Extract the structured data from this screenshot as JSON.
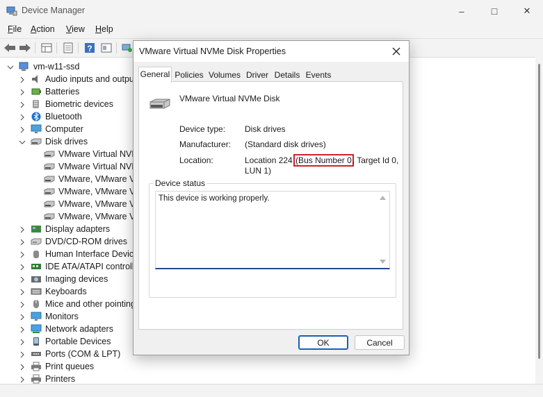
{
  "window": {
    "title": "Device Manager",
    "controls": {
      "minimize": "–",
      "maximize": "□",
      "close": "✕"
    }
  },
  "menu": [
    {
      "key": "F",
      "rest": "ile"
    },
    {
      "key": "A",
      "rest": "ction"
    },
    {
      "key": "V",
      "rest": "iew"
    },
    {
      "key": "H",
      "rest": "elp"
    }
  ],
  "toolbar_icons": [
    "back-icon",
    "forward-icon",
    "properties-grid-icon",
    "doc-icon",
    "help-icon",
    "view-icon",
    "computer-scan-icon"
  ],
  "tree": {
    "root": "vm-w11-ssd",
    "categories_top": [
      {
        "label": "Audio inputs and outputs",
        "icon": "speaker-icon"
      },
      {
        "label": "Batteries",
        "icon": "battery-icon"
      },
      {
        "label": "Biometric devices",
        "icon": "fingerprint-icon"
      },
      {
        "label": "Bluetooth",
        "icon": "bluetooth-icon"
      },
      {
        "label": "Computer",
        "icon": "monitor-icon"
      },
      {
        "label": "Disk drives",
        "icon": "disk-icon"
      }
    ],
    "disk_children": [
      "VMware Virtual NVMe Disk",
      "VMware Virtual NVMe Disk",
      "VMware, VMware Virtual S",
      "VMware, VMware Virtual S",
      "VMware, VMware Virtual S",
      "VMware, VMware Virtual S"
    ],
    "categories_bottom": [
      {
        "label": "Display adapters",
        "icon": "display-icon"
      },
      {
        "label": "DVD/CD-ROM drives",
        "icon": "dvd-icon"
      },
      {
        "label": "Human Interface Devices",
        "icon": "hid-icon"
      },
      {
        "label": "IDE ATA/ATAPI controllers",
        "icon": "ide-icon"
      },
      {
        "label": "Imaging devices",
        "icon": "camera-icon"
      },
      {
        "label": "Keyboards",
        "icon": "keyboard-icon"
      },
      {
        "label": "Mice and other pointing devices",
        "icon": "mouse-icon"
      },
      {
        "label": "Monitors",
        "icon": "monitor-icon"
      },
      {
        "label": "Network adapters",
        "icon": "network-icon"
      },
      {
        "label": "Portable Devices",
        "icon": "portable-icon"
      },
      {
        "label": "Ports (COM & LPT)",
        "icon": "port-icon"
      },
      {
        "label": "Print queues",
        "icon": "printer-icon"
      },
      {
        "label": "Printers",
        "icon": "printer-icon"
      }
    ]
  },
  "dialog": {
    "title": "VMware Virtual NVMe Disk Properties",
    "tabs": [
      "General",
      "Policies",
      "Volumes",
      "Driver",
      "Details",
      "Events"
    ],
    "active_tab": "General",
    "device_name": "VMware Virtual NVMe Disk",
    "device_type_label": "Device type:",
    "device_type_value": "Disk drives",
    "manufacturer_label": "Manufacturer:",
    "manufacturer_value": "(Standard disk drives)",
    "location_label": "Location:",
    "location_before": "Location 224 ",
    "location_highlight": "(Bus Number 0",
    "location_after": ", Target Id 0,",
    "location_line2": "LUN 1)",
    "status_group_label": "Device status",
    "status_text": "This device is working properly.",
    "ok_label": "OK",
    "cancel_label": "Cancel",
    "highlight_color": "#d0202a"
  }
}
